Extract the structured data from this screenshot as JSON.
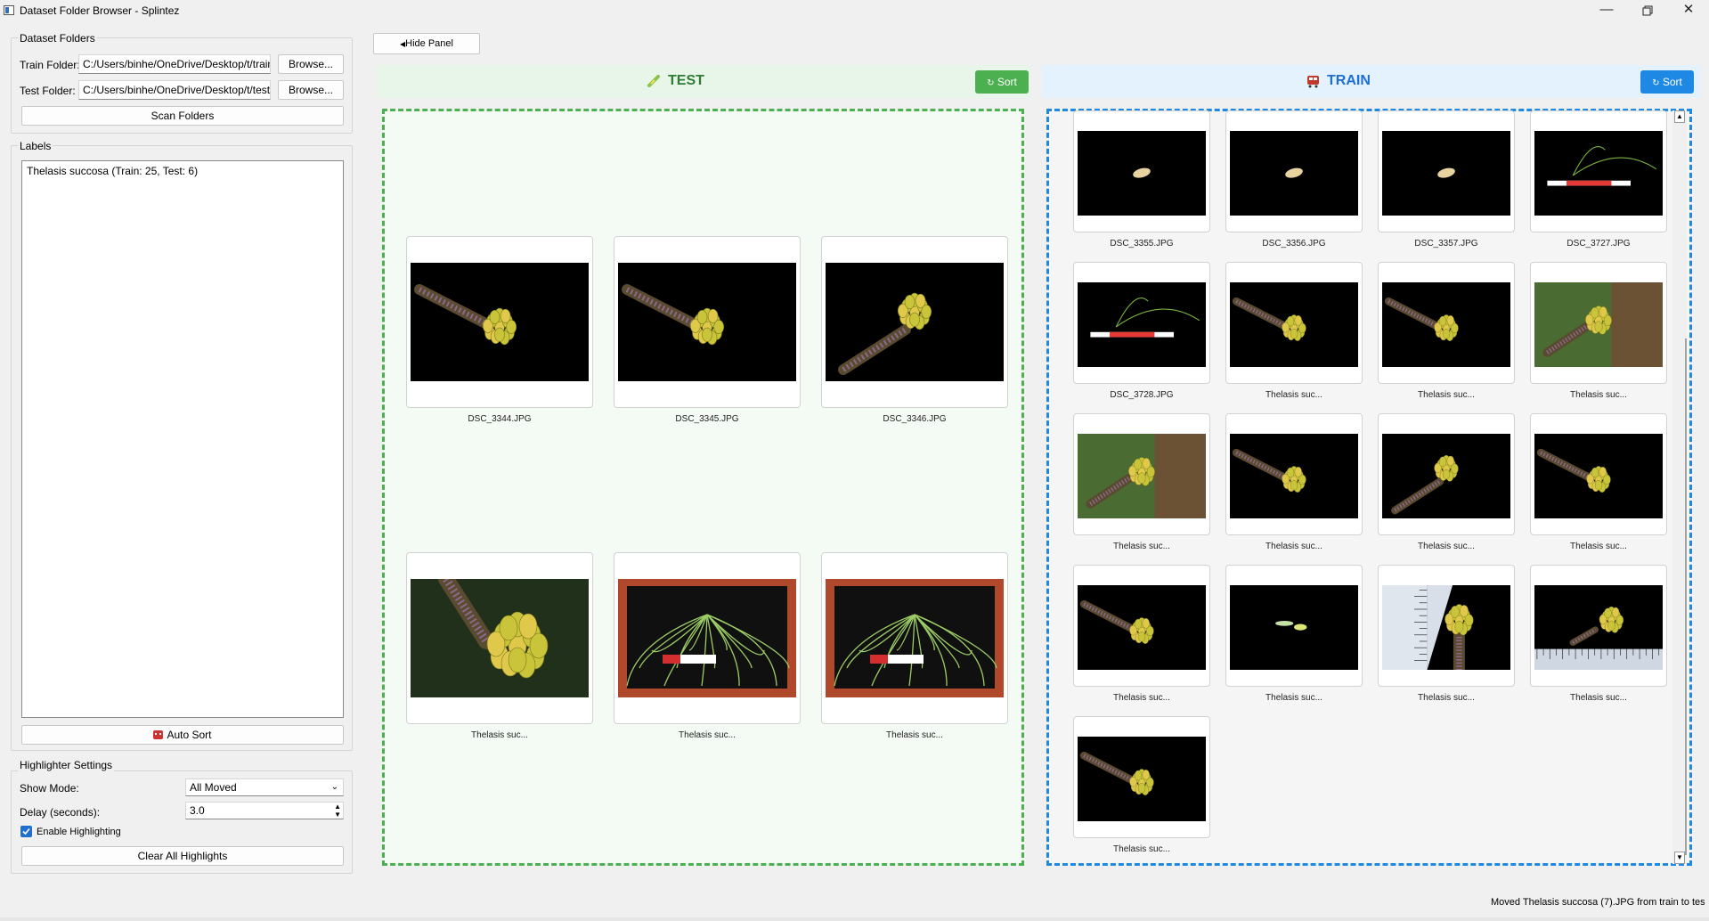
{
  "window": {
    "title": "Dataset Folder Browser - Splintez",
    "controls": [
      "minimize-icon",
      "restore-icon",
      "close-icon"
    ]
  },
  "dataset_folders": {
    "title": "Dataset Folders",
    "train_label": "Train Folder:",
    "train_path": "C:/Users/binhe/OneDrive/Desktop/t/train",
    "test_label": "Test Folder:",
    "test_path": "C:/Users/binhe/OneDrive/Desktop/t/test",
    "browse_label": "Browse...",
    "scan_label": "Scan Folders"
  },
  "labels": {
    "title": "Labels",
    "items": [
      "Thelasis succosa (Train: 25, Test: 6)"
    ],
    "auto_sort_label": "Auto Sort"
  },
  "highlighter": {
    "title": "Highlighter Settings",
    "show_mode_label": "Show Mode:",
    "show_mode_value": "All Moved",
    "delay_label": "Delay (seconds):",
    "delay_value": "3.0",
    "enable_label": "Enable Highlighting",
    "enable_checked": true,
    "clear_label": "Clear All Highlights"
  },
  "toolbar": {
    "hide_panel_label": "Hide Panel"
  },
  "test_panel": {
    "title": "TEST",
    "sort_label": "Sort",
    "accent": "#4caf50",
    "items": [
      {
        "caption": "DSC_3344.JPG",
        "kind": "flower-dark-a"
      },
      {
        "caption": "DSC_3345.JPG",
        "kind": "flower-dark-a"
      },
      {
        "caption": "DSC_3346.JPG",
        "kind": "flower-dark-b"
      },
      {
        "caption": "Thelasis suc...",
        "kind": "flower-closeup"
      },
      {
        "caption": "Thelasis suc...",
        "kind": "plant-ruler"
      },
      {
        "caption": "Thelasis suc...",
        "kind": "plant-ruler"
      }
    ]
  },
  "train_panel": {
    "title": "TRAIN",
    "sort_label": "Sort",
    "accent": "#1e88e5",
    "items": [
      {
        "caption": "DSC_3355.JPG",
        "kind": "seed"
      },
      {
        "caption": "DSC_3356.JPG",
        "kind": "seed"
      },
      {
        "caption": "DSC_3357.JPG",
        "kind": "seed"
      },
      {
        "caption": "DSC_3727.JPG",
        "kind": "plant-white-ruler"
      },
      {
        "caption": "DSC_3728.JPG",
        "kind": "plant-white-ruler"
      },
      {
        "caption": "Thelasis suc...",
        "kind": "flower-dark-a"
      },
      {
        "caption": "Thelasis suc...",
        "kind": "flower-dark-a"
      },
      {
        "caption": "Thelasis suc...",
        "kind": "flower-green-bg"
      },
      {
        "caption": "Thelasis suc...",
        "kind": "flower-green-bg"
      },
      {
        "caption": "Thelasis suc...",
        "kind": "flower-dark-a"
      },
      {
        "caption": "Thelasis suc...",
        "kind": "flower-dark-b"
      },
      {
        "caption": "Thelasis suc...",
        "kind": "flower-dark-a"
      },
      {
        "caption": "Thelasis suc...",
        "kind": "flower-dark-a"
      },
      {
        "caption": "Thelasis suc...",
        "kind": "green-bits"
      },
      {
        "caption": "Thelasis suc...",
        "kind": "flower-scale"
      },
      {
        "caption": "Thelasis suc...",
        "kind": "flower-scale-bottom"
      },
      {
        "caption": "Thelasis suc...",
        "kind": "flower-dark-a"
      }
    ]
  },
  "status": "Moved Thelasis succosa (7).JPG from train to tes"
}
